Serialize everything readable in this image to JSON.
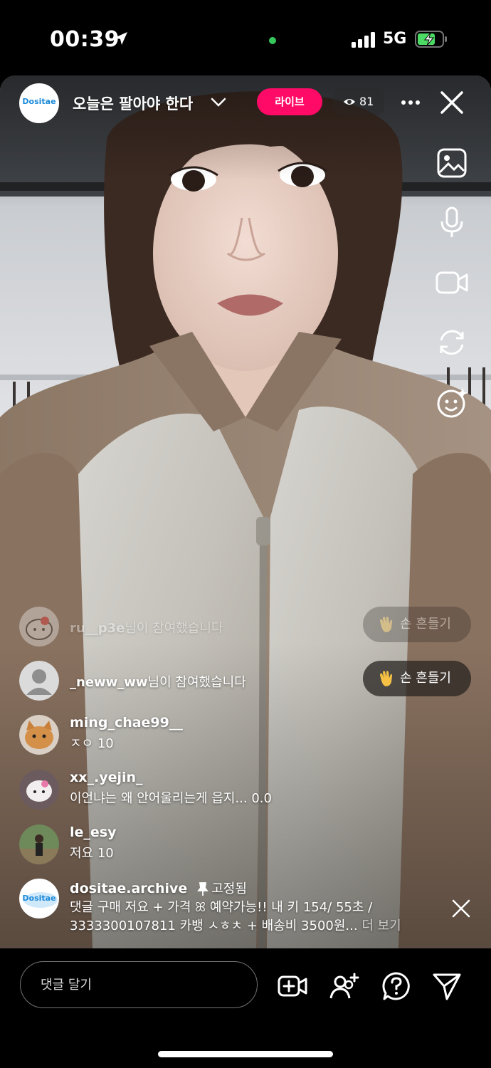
{
  "status_bar": {
    "time": "00:39",
    "network": "5G",
    "icons": [
      "location-arrow-icon",
      "signal-bars-icon",
      "battery-charging-icon"
    ]
  },
  "header": {
    "host_logo_text": "Dositae",
    "title": "오늘은 팔아야 한다",
    "live_label": "라이브",
    "viewer_count": "81"
  },
  "side_tools": [
    "gallery-icon",
    "microphone-icon",
    "video-camera-icon",
    "flip-camera-icon",
    "face-effects-icon"
  ],
  "comments": {
    "joined_faded": {
      "username": "ru__p3e",
      "suffix": "님이 참여했습니다",
      "wave_label": "손 흔들기"
    },
    "joined": {
      "username": "_neww_ww",
      "suffix": "님이 참여했습니다",
      "wave_label": "손 흔들기"
    },
    "messages": [
      {
        "username": "ming_chae99__",
        "text": "ㅈㅇ 10"
      },
      {
        "username": "xx_.yejin_",
        "text": "이언냐는 왜 안어울리는게 읍지... 0.0"
      },
      {
        "username": "le_esy",
        "text": "저요 10"
      }
    ],
    "pinned": {
      "username": "dositae.archive",
      "pinned_label": "고정됨",
      "text": "댓글 구매 저요 + 가격 ꕤ 예약가능!! 내 키 154/ 55초 / 3333300107811 카뱅 ㅅㅎㅊ + 배송비 3500원...",
      "more": "더 보기"
    }
  },
  "bottom_bar": {
    "comment_placeholder": "댓글 달기",
    "icons": [
      "add-video-guest-icon",
      "invite-users-icon",
      "question-icon",
      "send-icon"
    ]
  },
  "colors": {
    "live_badge": "#ff0a66",
    "background": "#000000",
    "camera_dot": "#35c759",
    "battery_charge": "#4cd964"
  }
}
